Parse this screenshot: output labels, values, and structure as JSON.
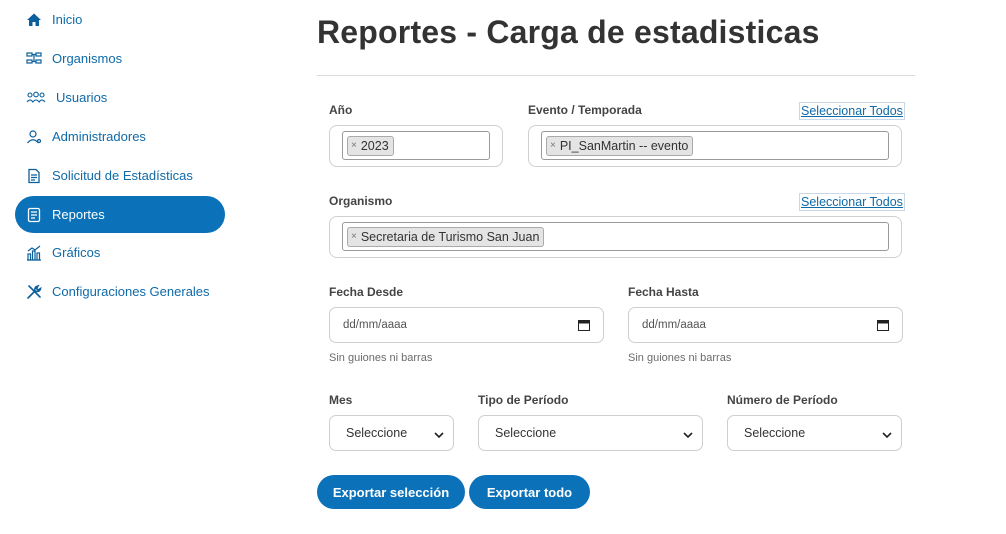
{
  "sidebar": {
    "items": [
      {
        "label": "Inicio",
        "icon": "home-icon"
      },
      {
        "label": "Organismos",
        "icon": "organization-icon"
      },
      {
        "label": "Usuarios",
        "icon": "users-icon"
      },
      {
        "label": "Administradores",
        "icon": "admin-icon"
      },
      {
        "label": "Solicitud de Estadísticas",
        "icon": "document-icon"
      },
      {
        "label": "Reportes",
        "icon": "report-icon",
        "active": true
      },
      {
        "label": "Gráficos",
        "icon": "chart-icon"
      },
      {
        "label": "Configuraciones Generales",
        "icon": "tools-icon"
      }
    ]
  },
  "page": {
    "title": "Reportes - Carga de estadisticas"
  },
  "form": {
    "anio": {
      "label": "Año",
      "selected": "2023"
    },
    "evento": {
      "label": "Evento / Temporada",
      "select_all": "Seleccionar Todos",
      "selected": "PI_SanMartin -- evento"
    },
    "organismo": {
      "label": "Organismo",
      "select_all": "Seleccionar Todos",
      "selected": "Secretaria de Turismo San Juan"
    },
    "fecha_desde": {
      "label": "Fecha Desde",
      "placeholder": "dd/mm/aaaa",
      "hint": "Sin guiones ni barras"
    },
    "fecha_hasta": {
      "label": "Fecha Hasta",
      "placeholder": "dd/mm/aaaa",
      "hint": "Sin guiones ni barras"
    },
    "mes": {
      "label": "Mes",
      "value": "Seleccione"
    },
    "tipo_periodo": {
      "label": "Tipo de Período",
      "value": "Seleccione"
    },
    "numero_periodo": {
      "label": "Número de Período",
      "value": "Seleccione"
    },
    "remove_symbol": "×"
  },
  "actions": {
    "export_selection": "Exportar selección",
    "export_all": "Exportar todo"
  },
  "colors": {
    "primary": "#0b72b9",
    "link": "#0f6aa8"
  }
}
